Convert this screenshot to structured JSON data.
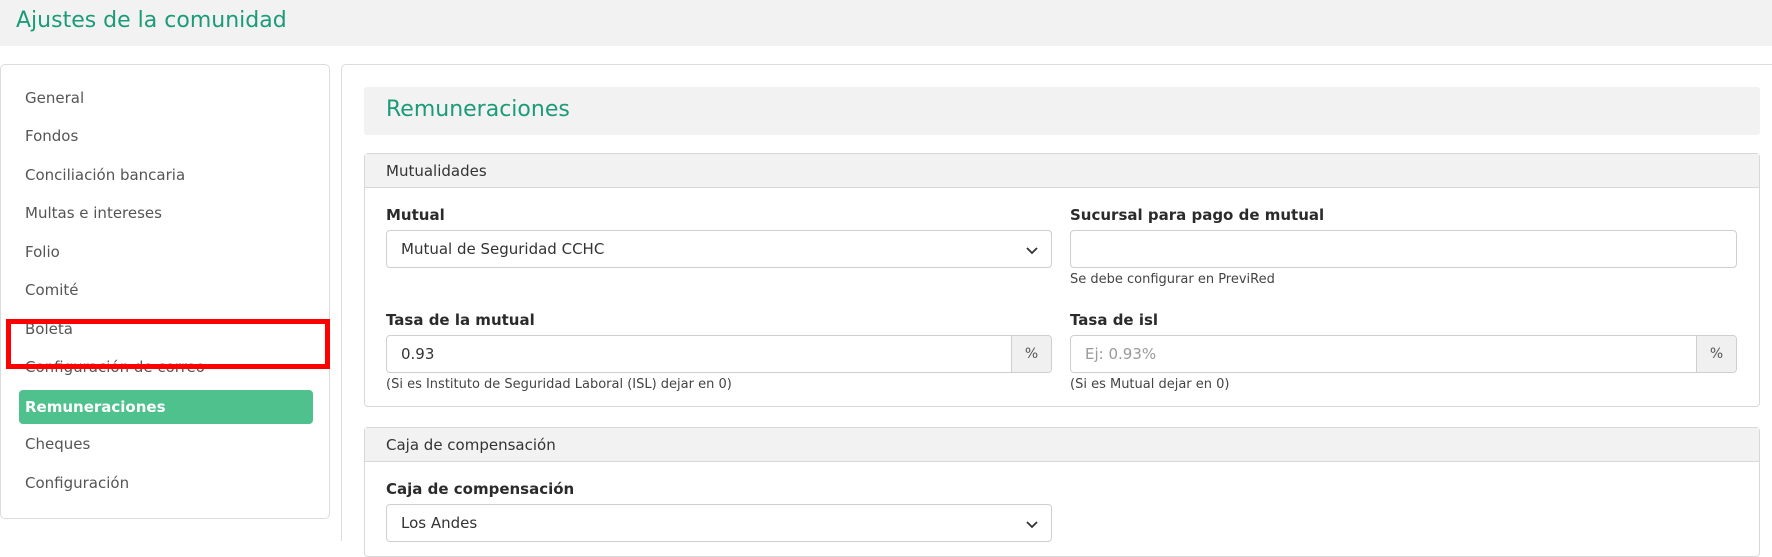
{
  "header": {
    "title": "Ajustes de la comunidad"
  },
  "sidebar": {
    "items": [
      {
        "label": "General"
      },
      {
        "label": "Fondos"
      },
      {
        "label": "Conciliación bancaria"
      },
      {
        "label": "Multas e intereses"
      },
      {
        "label": "Folio"
      },
      {
        "label": "Comité"
      },
      {
        "label": "Boleta"
      },
      {
        "label": "Configuración de correo"
      },
      {
        "label": "Remuneraciones"
      },
      {
        "label": "Cheques"
      },
      {
        "label": "Configuración"
      }
    ],
    "active_item": "Remuneraciones"
  },
  "main": {
    "title": "Remuneraciones",
    "mutualidades": {
      "heading": "Mutualidades",
      "mutual": {
        "label": "Mutual",
        "value": "Mutual de Seguridad CCHC"
      },
      "sucursal": {
        "label": "Sucursal para pago de mutual",
        "value": "",
        "help": "Se debe configurar en PreviRed"
      },
      "tasa_mutual": {
        "label": "Tasa de la mutual",
        "value": "0.93",
        "addon": "%",
        "help": "(Si es Instituto de Seguridad Laboral (ISL) dejar en 0)"
      },
      "tasa_isl": {
        "label": "Tasa de isl",
        "value": "",
        "placeholder": "Ej: 0.93%",
        "addon": "%",
        "help": "(Si es Mutual dejar en 0)"
      }
    },
    "caja": {
      "heading": "Caja de compensación",
      "caja": {
        "label": "Caja de compensación",
        "value": "Los Andes"
      }
    }
  },
  "colors": {
    "accent": "#1c9b78",
    "active_bg": "#4fc18c",
    "highlight": "#ff0000"
  }
}
